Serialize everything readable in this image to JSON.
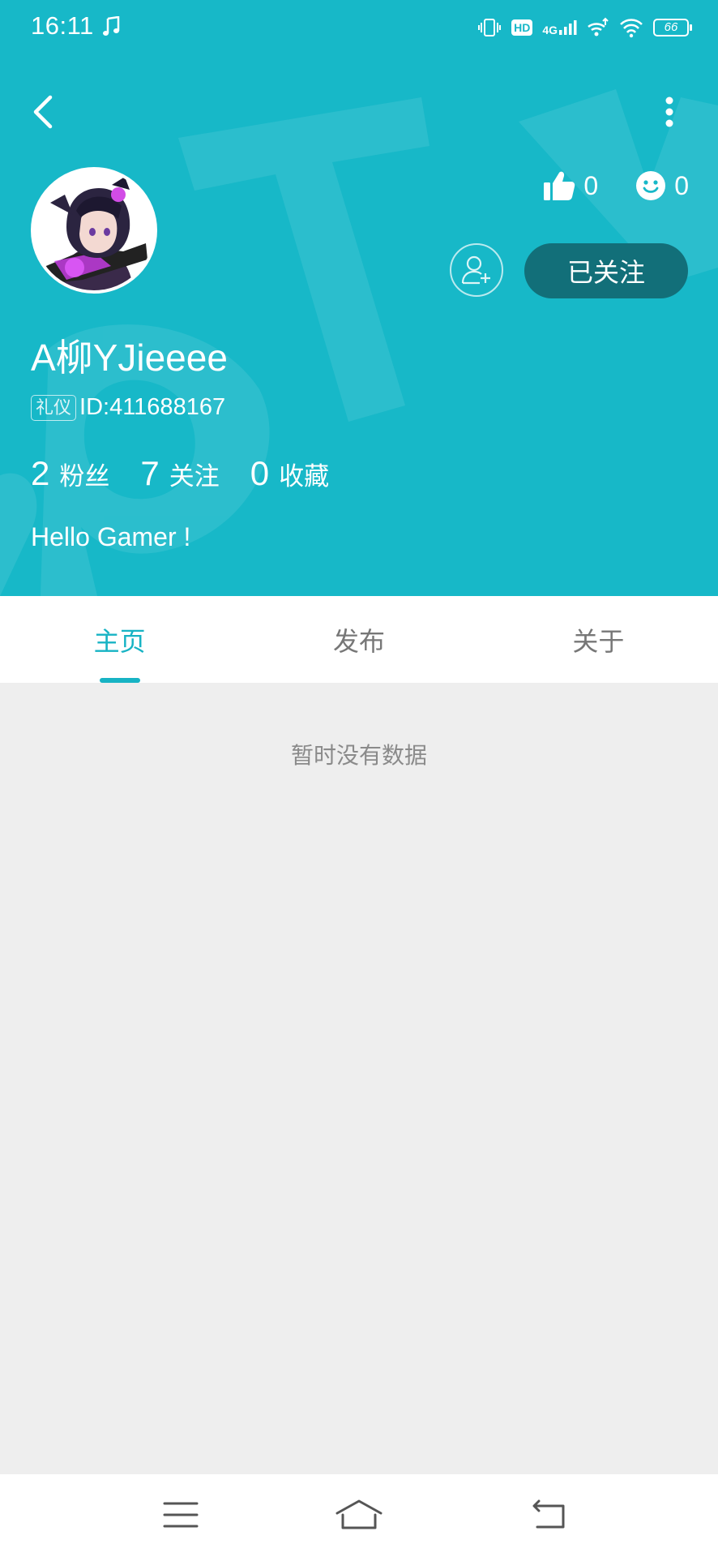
{
  "status_bar": {
    "time": "16:11",
    "hd": "HD",
    "network": "4G",
    "battery": "66"
  },
  "profile": {
    "username": "A柳YJieeee",
    "badge": "礼仪",
    "id_text": "ID:411688167",
    "likes": "0",
    "reactions": "0",
    "follow_label": "已关注",
    "bio": "Hello Gamer !",
    "counts": [
      {
        "value": "2",
        "label": "粉丝"
      },
      {
        "value": "7",
        "label": "关注"
      },
      {
        "value": "0",
        "label": "收藏"
      }
    ]
  },
  "tabs": [
    {
      "label": "主页",
      "active": true
    },
    {
      "label": "发布",
      "active": false
    },
    {
      "label": "关于",
      "active": false
    }
  ],
  "empty_state": "暂时没有数据",
  "colors": {
    "header_bg": "#17b8c8",
    "follow_button_bg": "#126f79",
    "accent": "#17b3c4",
    "content_bg": "#eeeeee"
  },
  "icons": {
    "back": "back-arrow-icon",
    "more": "more-vertical-icon",
    "like": "thumbs-up-icon",
    "reaction": "smiley-icon",
    "add_friend": "add-user-icon",
    "nav_menu": "menu-icon",
    "nav_home": "home-icon",
    "nav_back": "back-return-icon"
  }
}
